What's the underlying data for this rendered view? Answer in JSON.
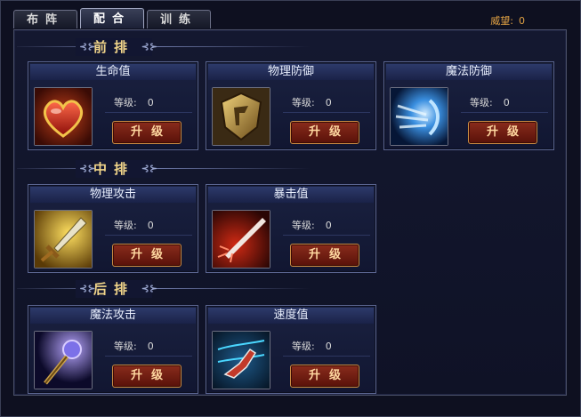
{
  "tabs": [
    {
      "label": "布阵"
    },
    {
      "label": "配合"
    },
    {
      "label": "训练"
    }
  ],
  "active_tab": "配合",
  "prestige": {
    "label": "威望:",
    "value": "0"
  },
  "sections": {
    "front": "前排",
    "middle": "中排",
    "back": "后排"
  },
  "cards": {
    "hp": {
      "title": "生命值",
      "level_label": "等级:",
      "level": "0",
      "button": "升级",
      "icon": "heart-icon"
    },
    "pdef": {
      "title": "物理防御",
      "level_label": "等级:",
      "level": "0",
      "button": "升级",
      "icon": "shield-icon"
    },
    "mdef": {
      "title": "魔法防御",
      "level_label": "等级:",
      "level": "0",
      "button": "升级",
      "icon": "magic-shield-icon"
    },
    "patk": {
      "title": "物理攻击",
      "level_label": "等级:",
      "level": "0",
      "button": "升级",
      "icon": "sword-icon"
    },
    "crit": {
      "title": "暴击值",
      "level_label": "等级:",
      "level": "0",
      "button": "升级",
      "icon": "blade-icon"
    },
    "matk": {
      "title": "魔法攻击",
      "level_label": "等级:",
      "level": "0",
      "button": "升级",
      "icon": "staff-icon"
    },
    "speed": {
      "title": "速度值",
      "level_label": "等级:",
      "level": "0",
      "button": "升级",
      "icon": "speed-boot-icon"
    }
  }
}
